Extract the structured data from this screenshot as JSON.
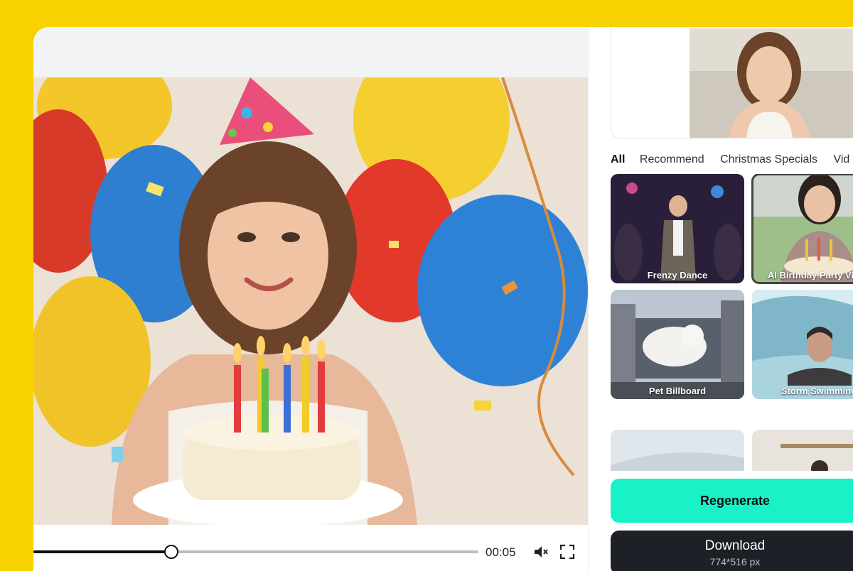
{
  "player": {
    "time": "00:05",
    "progress": 0.31,
    "icons": [
      "mute-icon",
      "fullscreen-icon"
    ]
  },
  "tabs": [
    {
      "label": "All",
      "active": true
    },
    {
      "label": "Recommend",
      "active": false
    },
    {
      "label": "Christmas Specials",
      "active": false
    },
    {
      "label": "Vid",
      "active": false
    }
  ],
  "templates": [
    {
      "label": "Frenzy Dance",
      "selected": false
    },
    {
      "label": "AI Birthday Party Video",
      "selected": true
    },
    {
      "label": "Pet Billboard",
      "selected": false
    },
    {
      "label": "Storm Swimming",
      "selected": false
    },
    {
      "label": "",
      "selected": false
    },
    {
      "label": "",
      "selected": false
    }
  ],
  "actions": {
    "regenerate": "Regenerate",
    "download": "Download",
    "download_size": "774*516 px"
  },
  "colors": {
    "background": "#f7d200",
    "regenerate": "#18f2c6",
    "download": "#1e2027"
  }
}
